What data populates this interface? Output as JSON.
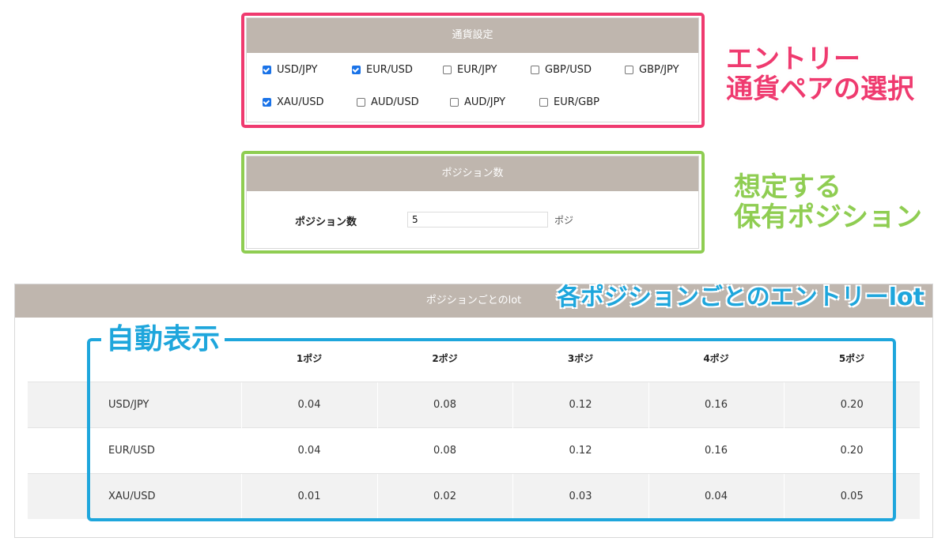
{
  "currency_panel": {
    "title": "通貨設定",
    "row1": [
      {
        "label": "USD/JPY",
        "checked": true
      },
      {
        "label": "EUR/USD",
        "checked": true
      },
      {
        "label": "EUR/JPY",
        "checked": false
      },
      {
        "label": "GBP/USD",
        "checked": false
      },
      {
        "label": "GBP/JPY",
        "checked": false
      }
    ],
    "row2": [
      {
        "label": "XAU/USD",
        "checked": true
      },
      {
        "label": "AUD/USD",
        "checked": false
      },
      {
        "label": "AUD/JPY",
        "checked": false
      },
      {
        "label": "EUR/GBP",
        "checked": false
      }
    ]
  },
  "position_panel": {
    "title": "ポジション数",
    "label": "ポジション数",
    "value": "5",
    "unit": "ポジ"
  },
  "lot_panel": {
    "title": "ポジションごとのlot",
    "headers": [
      "",
      "1ポジ",
      "2ポジ",
      "3ポジ",
      "4ポジ",
      "5ポジ"
    ],
    "rows": [
      [
        "USD/JPY",
        "0.04",
        "0.08",
        "0.12",
        "0.16",
        "0.20"
      ],
      [
        "EUR/USD",
        "0.04",
        "0.08",
        "0.12",
        "0.16",
        "0.20"
      ],
      [
        "XAU/USD",
        "0.01",
        "0.02",
        "0.03",
        "0.04",
        "0.05"
      ]
    ]
  },
  "annotations": {
    "pink_line1": "エントリー",
    "pink_line2": "通貨ペアの選択",
    "green_line1": "想定する",
    "green_line2": "保有ポジション",
    "blue_top": "各ポジションごとのエントリーlot",
    "blue_left": "自動表示"
  },
  "colors": {
    "header_bg": "#bfb6ae",
    "checkbox_checked": "#1a73e8",
    "annotation_pink": "#ef3a6f",
    "annotation_green": "#8fcd52",
    "annotation_blue": "#1ea6dc"
  }
}
